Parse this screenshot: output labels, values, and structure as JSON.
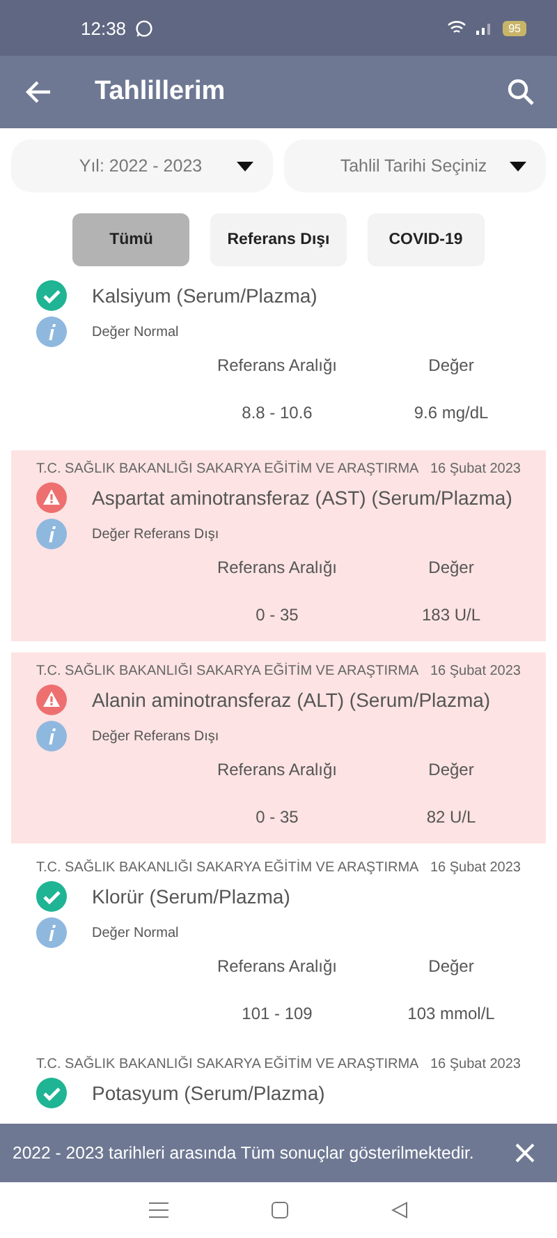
{
  "status_bar": {
    "time": "12:38",
    "battery": "95"
  },
  "app_bar": {
    "title": "Tahlillerim"
  },
  "filters": [
    {
      "label": "Yıl: 2022 - 2023"
    },
    {
      "label": "Tahlil Tarihi Seçiniz"
    }
  ],
  "chips": [
    {
      "label": "Tümü",
      "selected": true
    },
    {
      "label": "Referans Dışı",
      "selected": false
    },
    {
      "label": "COVID-19",
      "selected": false
    }
  ],
  "results": [
    {
      "kind": "normal",
      "name": "Kalsiyum (Serum/Plazma)",
      "status": "Değer Normal",
      "range_label": "Referans Aralığı",
      "value_label": "Değer",
      "range": "8.8 - 10.6",
      "value": "9.6 mg/dL"
    },
    {
      "kind": "abnormal",
      "institution": "T.C. SAĞLIK BAKANLIĞI SAKARYA EĞİTİM VE ARAŞTIRMA",
      "date": "16 Şubat 2023",
      "name": "Aspartat aminotransferaz (AST) (Serum/Plazma)",
      "status": "Değer Referans Dışı",
      "range_label": "Referans Aralığı",
      "value_label": "Değer",
      "range": "0 - 35",
      "value": "183 U/L"
    },
    {
      "kind": "abnormal",
      "institution": "T.C. SAĞLIK BAKANLIĞI SAKARYA EĞİTİM VE ARAŞTIRMA",
      "date": "16 Şubat 2023",
      "name": "Alanin aminotransferaz (ALT) (Serum/Plazma)",
      "status": "Değer Referans Dışı",
      "range_label": "Referans Aralığı",
      "value_label": "Değer",
      "range": "0 - 35",
      "value": "82 U/L"
    },
    {
      "kind": "normal",
      "institution": "T.C. SAĞLIK BAKANLIĞI SAKARYA EĞİTİM VE ARAŞTIRMA",
      "date": "16 Şubat 2023",
      "name": "Klorür (Serum/Plazma)",
      "status": "Değer Normal",
      "range_label": "Referans Aralığı",
      "value_label": "Değer",
      "range": "101 - 109",
      "value": "103 mmol/L"
    },
    {
      "kind": "normal",
      "institution": "T.C. SAĞLIK BAKANLIĞI SAKARYA EĞİTİM VE ARAŞTIRMA",
      "date": "16 Şubat 2023",
      "name": "Potasyum (Serum/Plazma)"
    }
  ],
  "snackbar": {
    "message": "2022 - 2023 tarihleri arasında Tüm sonuçlar gösterilmektedir."
  }
}
